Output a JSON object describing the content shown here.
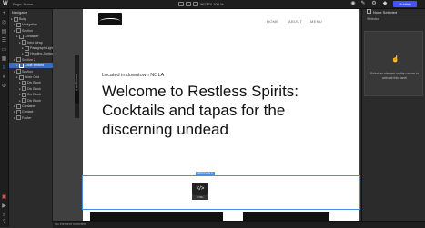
{
  "topbar": {
    "logo": "W",
    "page_info": "Page: Home",
    "size": "967 PX  100 %",
    "publish": "Publish"
  },
  "navigator": {
    "title": "Navigator",
    "rows": [
      {
        "label": "Body",
        "indent": 0
      },
      {
        "label": "Navigation",
        "indent": 1
      },
      {
        "label": "Section",
        "indent": 1
      },
      {
        "label": "Container",
        "indent": 2
      },
      {
        "label": "Intro Wrap",
        "indent": 3
      },
      {
        "label": "Paragraph Light",
        "indent": 4
      },
      {
        "label": "Heading Jumbo",
        "indent": 4
      },
      {
        "label": "Section 2",
        "indent": 1
      },
      {
        "label": "Code Embed",
        "indent": 2,
        "selected": true
      },
      {
        "label": "Section",
        "indent": 1
      },
      {
        "label": "Work Grid",
        "indent": 2
      },
      {
        "label": "Div Block",
        "indent": 3
      },
      {
        "label": "Div Block",
        "indent": 3
      },
      {
        "label": "Div Block",
        "indent": 3
      },
      {
        "label": "Div Block",
        "indent": 3
      },
      {
        "label": "Container",
        "indent": 1
      },
      {
        "label": "Contact",
        "indent": 1
      },
      {
        "label": "Footer",
        "indent": 1
      }
    ]
  },
  "site": {
    "nav_links": [
      "HOME",
      "ABOUT",
      "MENU"
    ],
    "kicker": "Located in downtown NOLA",
    "headline": "Welcome to Restless Spirits: Cocktails and tapas for the discerning undead",
    "embed_tag": "SECTION 2",
    "embed_label": "HTML"
  },
  "canvas": {
    "side_tab": "Choose an Element"
  },
  "right_panel": {
    "header": "None Selected",
    "subheader": "Selector",
    "empty_message": "Select an element on the canvas to activate this panel"
  },
  "status": {
    "text": "No Element Selected"
  },
  "colors": {
    "accent": "#4353ff",
    "selection": "#4a90e2"
  }
}
